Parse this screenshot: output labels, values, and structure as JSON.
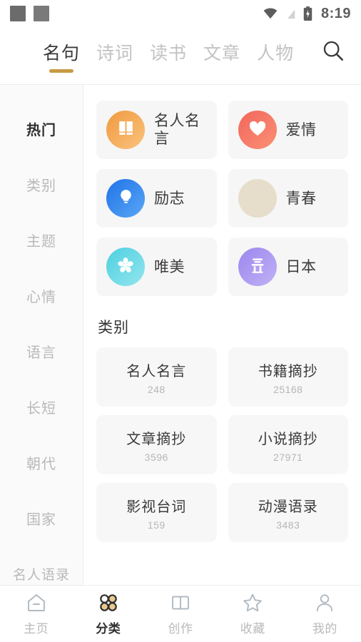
{
  "statusbar": {
    "time": "8:19",
    "icons": [
      "notification-square",
      "notification-square",
      "wifi-icon",
      "no-sim-icon",
      "battery-charging-icon"
    ]
  },
  "topbar": {
    "tabs": [
      {
        "label": "名句",
        "active": true
      },
      {
        "label": "诗词",
        "active": false
      },
      {
        "label": "读书",
        "active": false
      },
      {
        "label": "文章",
        "active": false
      },
      {
        "label": "人物",
        "active": false
      }
    ],
    "search_icon": "search-icon",
    "accent_color": "#c99a44"
  },
  "sidebar": {
    "items": [
      {
        "label": "热门",
        "active": true
      },
      {
        "label": "类别",
        "active": false
      },
      {
        "label": "主题",
        "active": false
      },
      {
        "label": "心情",
        "active": false
      },
      {
        "label": "语言",
        "active": false
      },
      {
        "label": "长短",
        "active": false
      },
      {
        "label": "朝代",
        "active": false
      },
      {
        "label": "国家",
        "active": false
      },
      {
        "label": "名人语录",
        "active": false
      }
    ]
  },
  "hot": {
    "cards": [
      {
        "label": "名人名言",
        "icon": "book-icon",
        "color_from": "#f0993f",
        "color_to": "#fac37e"
      },
      {
        "label": "爱情",
        "icon": "heart-icon",
        "color_from": "#f2665b",
        "color_to": "#fb9076"
      },
      {
        "label": "励志",
        "icon": "bulb-icon",
        "color_from": "#1f73e8",
        "color_to": "#5aa6f5"
      },
      {
        "label": "青春",
        "icon": "blank-icon",
        "color_from": "#e6ddcb",
        "color_to": "#e6ddcb"
      },
      {
        "label": "唯美",
        "icon": "flower-icon",
        "color_from": "#4ecfe0",
        "color_to": "#93e6ee"
      },
      {
        "label": "日本",
        "icon": "torii-icon",
        "color_from": "#9b86ee",
        "color_to": "#c0b2f5"
      }
    ]
  },
  "categories": {
    "title": "类别",
    "cards": [
      {
        "name": "名人名言",
        "count": "248"
      },
      {
        "name": "书籍摘抄",
        "count": "25168"
      },
      {
        "name": "文章摘抄",
        "count": "3596"
      },
      {
        "name": "小说摘抄",
        "count": "27971"
      },
      {
        "name": "影视台词",
        "count": "159"
      },
      {
        "name": "动漫语录",
        "count": "3483"
      }
    ]
  },
  "bottomnav": {
    "items": [
      {
        "label": "主页",
        "icon": "home-icon",
        "active": false
      },
      {
        "label": "分类",
        "icon": "grid-icon",
        "active": true
      },
      {
        "label": "创作",
        "icon": "book-open-icon",
        "active": false
      },
      {
        "label": "收藏",
        "icon": "star-icon",
        "active": false
      },
      {
        "label": "我的",
        "icon": "person-icon",
        "active": false
      }
    ]
  }
}
